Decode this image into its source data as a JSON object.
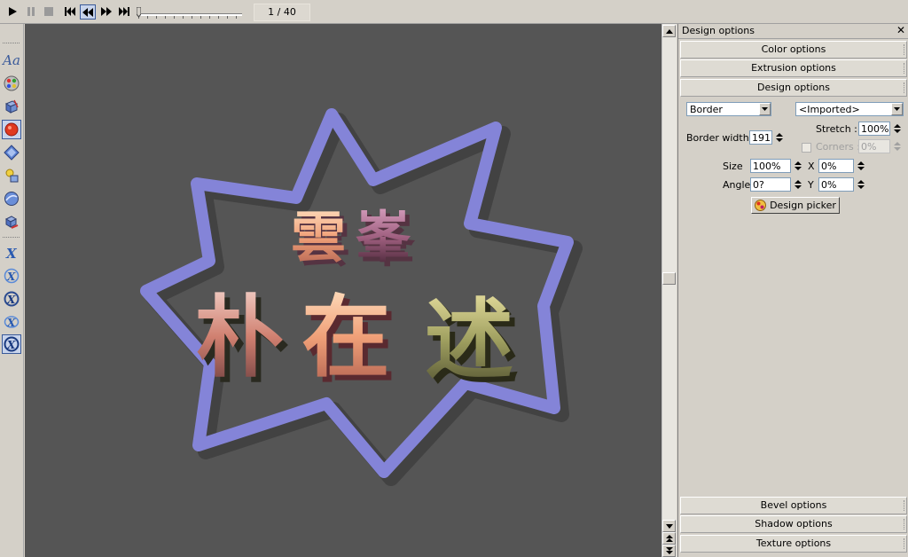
{
  "toolbar": {
    "buttons": [
      {
        "name": "play-icon"
      },
      {
        "name": "pause-icon"
      },
      {
        "name": "stop-icon"
      },
      {
        "name": "first-frame-icon"
      },
      {
        "name": "rewind-icon",
        "active": true
      },
      {
        "name": "fast-forward-icon"
      },
      {
        "name": "last-frame-icon"
      }
    ],
    "frame_counter": "1 / 40",
    "slider_position": 0
  },
  "left_tools": [
    {
      "name": "text-tool-icon",
      "label": "Aa"
    },
    {
      "name": "color-palette-icon"
    },
    {
      "name": "extrusion-cube-icon"
    },
    {
      "name": "design-circle-icon",
      "active": true
    },
    {
      "name": "bevel-diamond-icon"
    },
    {
      "name": "lighting-icon"
    },
    {
      "name": "texture-sphere-icon"
    },
    {
      "name": "shadow-cube-icon"
    },
    {
      "name": "rotate-x-icon"
    },
    {
      "name": "rotate-x2-icon"
    },
    {
      "name": "rotate-x3-icon"
    },
    {
      "name": "rotate-x4-icon"
    },
    {
      "name": "rotate-x5-icon",
      "active": true
    }
  ],
  "canvas": {
    "background": "#555555",
    "burst_color": "#8484d8",
    "top_text": [
      "雲",
      "峯"
    ],
    "main_text": [
      "朴",
      "在",
      "述"
    ]
  },
  "panel": {
    "title": "Design options",
    "sections_top": [
      "Color options",
      "Extrusion options",
      "Design options"
    ],
    "sections_bottom": [
      "Bevel options",
      "Shadow options",
      "Texture options"
    ],
    "design": {
      "type_value": "Border",
      "preset_value": "<Imported>",
      "stretch_label": "Stretch :",
      "stretch_value": "100%",
      "border_width_label": "Border width",
      "border_width_value": "191",
      "corners_label": "Corners :",
      "corners_value": "0%",
      "size_label": "Size",
      "size_value": "100%",
      "x_label": "X",
      "x_value": "0%",
      "angle_label": "Angle",
      "angle_value": "0?",
      "y_label": "Y",
      "y_value": "0%",
      "picker_label": "Design picker"
    }
  }
}
